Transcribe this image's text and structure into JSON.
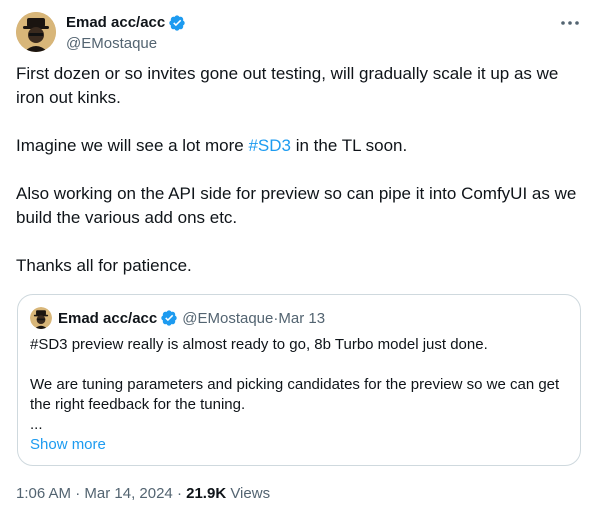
{
  "author": {
    "name": "Emad acc/acc",
    "handle": "@EMostaque"
  },
  "tweet": {
    "para1": "First dozen or so invites gone out testing, will gradually scale it up as we iron out kinks.",
    "para2_before": "Imagine we will see a lot more ",
    "para2_hashtag": "#SD3",
    "para2_after": " in the TL soon.",
    "para3": "Also working on the API side for preview so can pipe it into ComfyUI as we build the various add ons etc.",
    "para4": "Thanks all for patience."
  },
  "quote": {
    "name": "Emad acc/acc",
    "handle": "@EMostaque",
    "separator": " · ",
    "date": "Mar 13",
    "line1": "#SD3 preview really is almost ready to go, 8b Turbo model just done.",
    "line2": "We are tuning parameters and picking candidates for the preview so we can get the right feedback for the tuning.",
    "ellipsis": "...",
    "show_more": "Show more"
  },
  "footer": {
    "time": "1:06 AM",
    "separator": " · ",
    "date": "Mar 14, 2024",
    "views_count": "21.9K",
    "views_label": " Views"
  },
  "colors": {
    "accent": "#1d9bf0",
    "text": "#0f1419",
    "muted": "#536471",
    "border": "#cfd9de"
  },
  "icons": {
    "verified": "verified-badge-icon",
    "more": "more-options-icon"
  }
}
